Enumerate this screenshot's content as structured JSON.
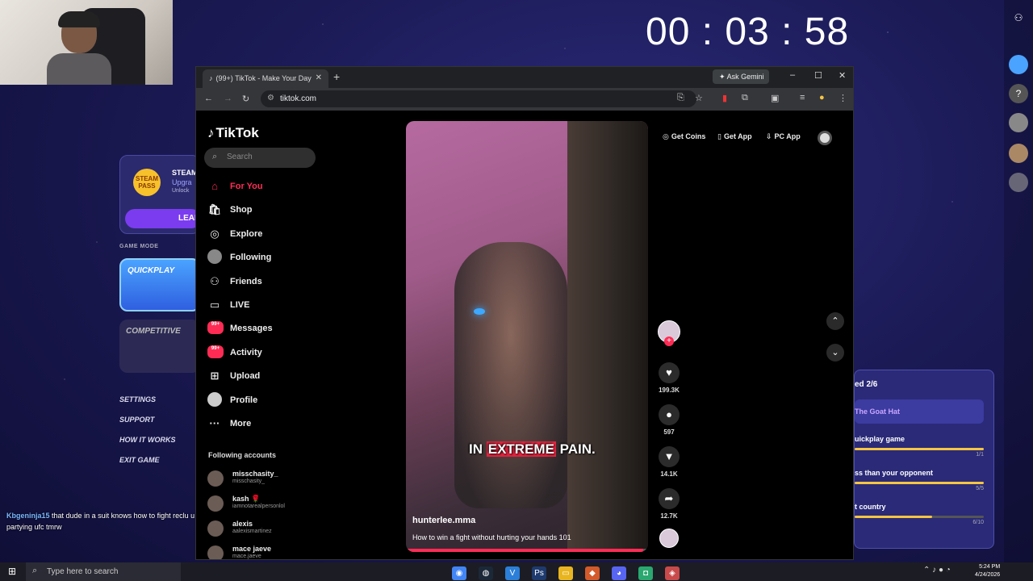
{
  "stream": {
    "timer": "00 : 03 : 58"
  },
  "game_panel": {
    "steam_badge": "STEAM PASS",
    "steam_title": "STEAM",
    "steam_upgrade": "Upgra",
    "steam_unlock": "Unlock",
    "learn_button": "LEAR",
    "game_mode_label": "GAME MODE",
    "quickplay_label": "QUICKPLAY",
    "competitive_label": "COMPETITIVE",
    "menu": [
      "SETTINGS",
      "SUPPORT",
      "HOW IT WORKS",
      "EXIT GAME"
    ]
  },
  "chat": {
    "user": "Kbgeninja15",
    "message": "that dude in a suit knows how to fight reclu  u watch partying ufc tmrw"
  },
  "quest": {
    "title": "ed 2/6",
    "highlight": "The Goat Hat",
    "rows": [
      {
        "name": "uickplay game",
        "count": "1/1",
        "progress": 1.0
      },
      {
        "name": "ss than your opponent",
        "count": "5/5",
        "progress": 1.0
      },
      {
        "name": "t country",
        "count": "6/10",
        "progress": 0.6
      }
    ]
  },
  "browser": {
    "tab_title": "(99+) TikTok - Make Your Day",
    "ask_gemini": "Ask Gemini",
    "url": "tiktok.com"
  },
  "tiktok": {
    "logo": "TikTok",
    "search_placeholder": "Search",
    "nav": [
      {
        "label": "For You",
        "icon": "home-icon",
        "active": true
      },
      {
        "label": "Shop",
        "icon": "shop-icon"
      },
      {
        "label": "Explore",
        "icon": "compass-icon"
      },
      {
        "label": "Following",
        "icon": "following-avatar"
      },
      {
        "label": "Friends",
        "icon": "friends-icon"
      },
      {
        "label": "LIVE",
        "icon": "live-icon"
      },
      {
        "label": "Messages",
        "icon": "messages-icon",
        "badge": "99+"
      },
      {
        "label": "Activity",
        "icon": "activity-icon",
        "badge": "99+"
      },
      {
        "label": "Upload",
        "icon": "upload-icon"
      },
      {
        "label": "Profile",
        "icon": "profile-avatar"
      },
      {
        "label": "More",
        "icon": "more-icon"
      }
    ],
    "following_header": "Following accounts",
    "following": [
      {
        "name": "misschasity_",
        "handle": "misschasity_"
      },
      {
        "name": "kash 🌹",
        "handle": "iamnotarealpersonlol"
      },
      {
        "name": "alexis",
        "handle": "aalexismartinez"
      },
      {
        "name": "mace jaeve",
        "handle": "mace.jaeve"
      }
    ],
    "top_actions": {
      "get_coins": "Get Coins",
      "get_app": "Get App",
      "pc_app": "PC App"
    },
    "video": {
      "caption_pre": "IN ",
      "caption_hl": "EXTREME",
      "caption_post": " PAIN.",
      "author": "hunterlee.mma",
      "description": "How to win a fight without hurting your hands 101",
      "progress": 0.98
    },
    "actions": {
      "likes": "199.3K",
      "comments": "597",
      "saves": "14.1K",
      "shares": "12.7K"
    }
  },
  "taskbar": {
    "search_placeholder": "Type here to search",
    "time": "5:24 PM",
    "date": "4/24/2026"
  }
}
